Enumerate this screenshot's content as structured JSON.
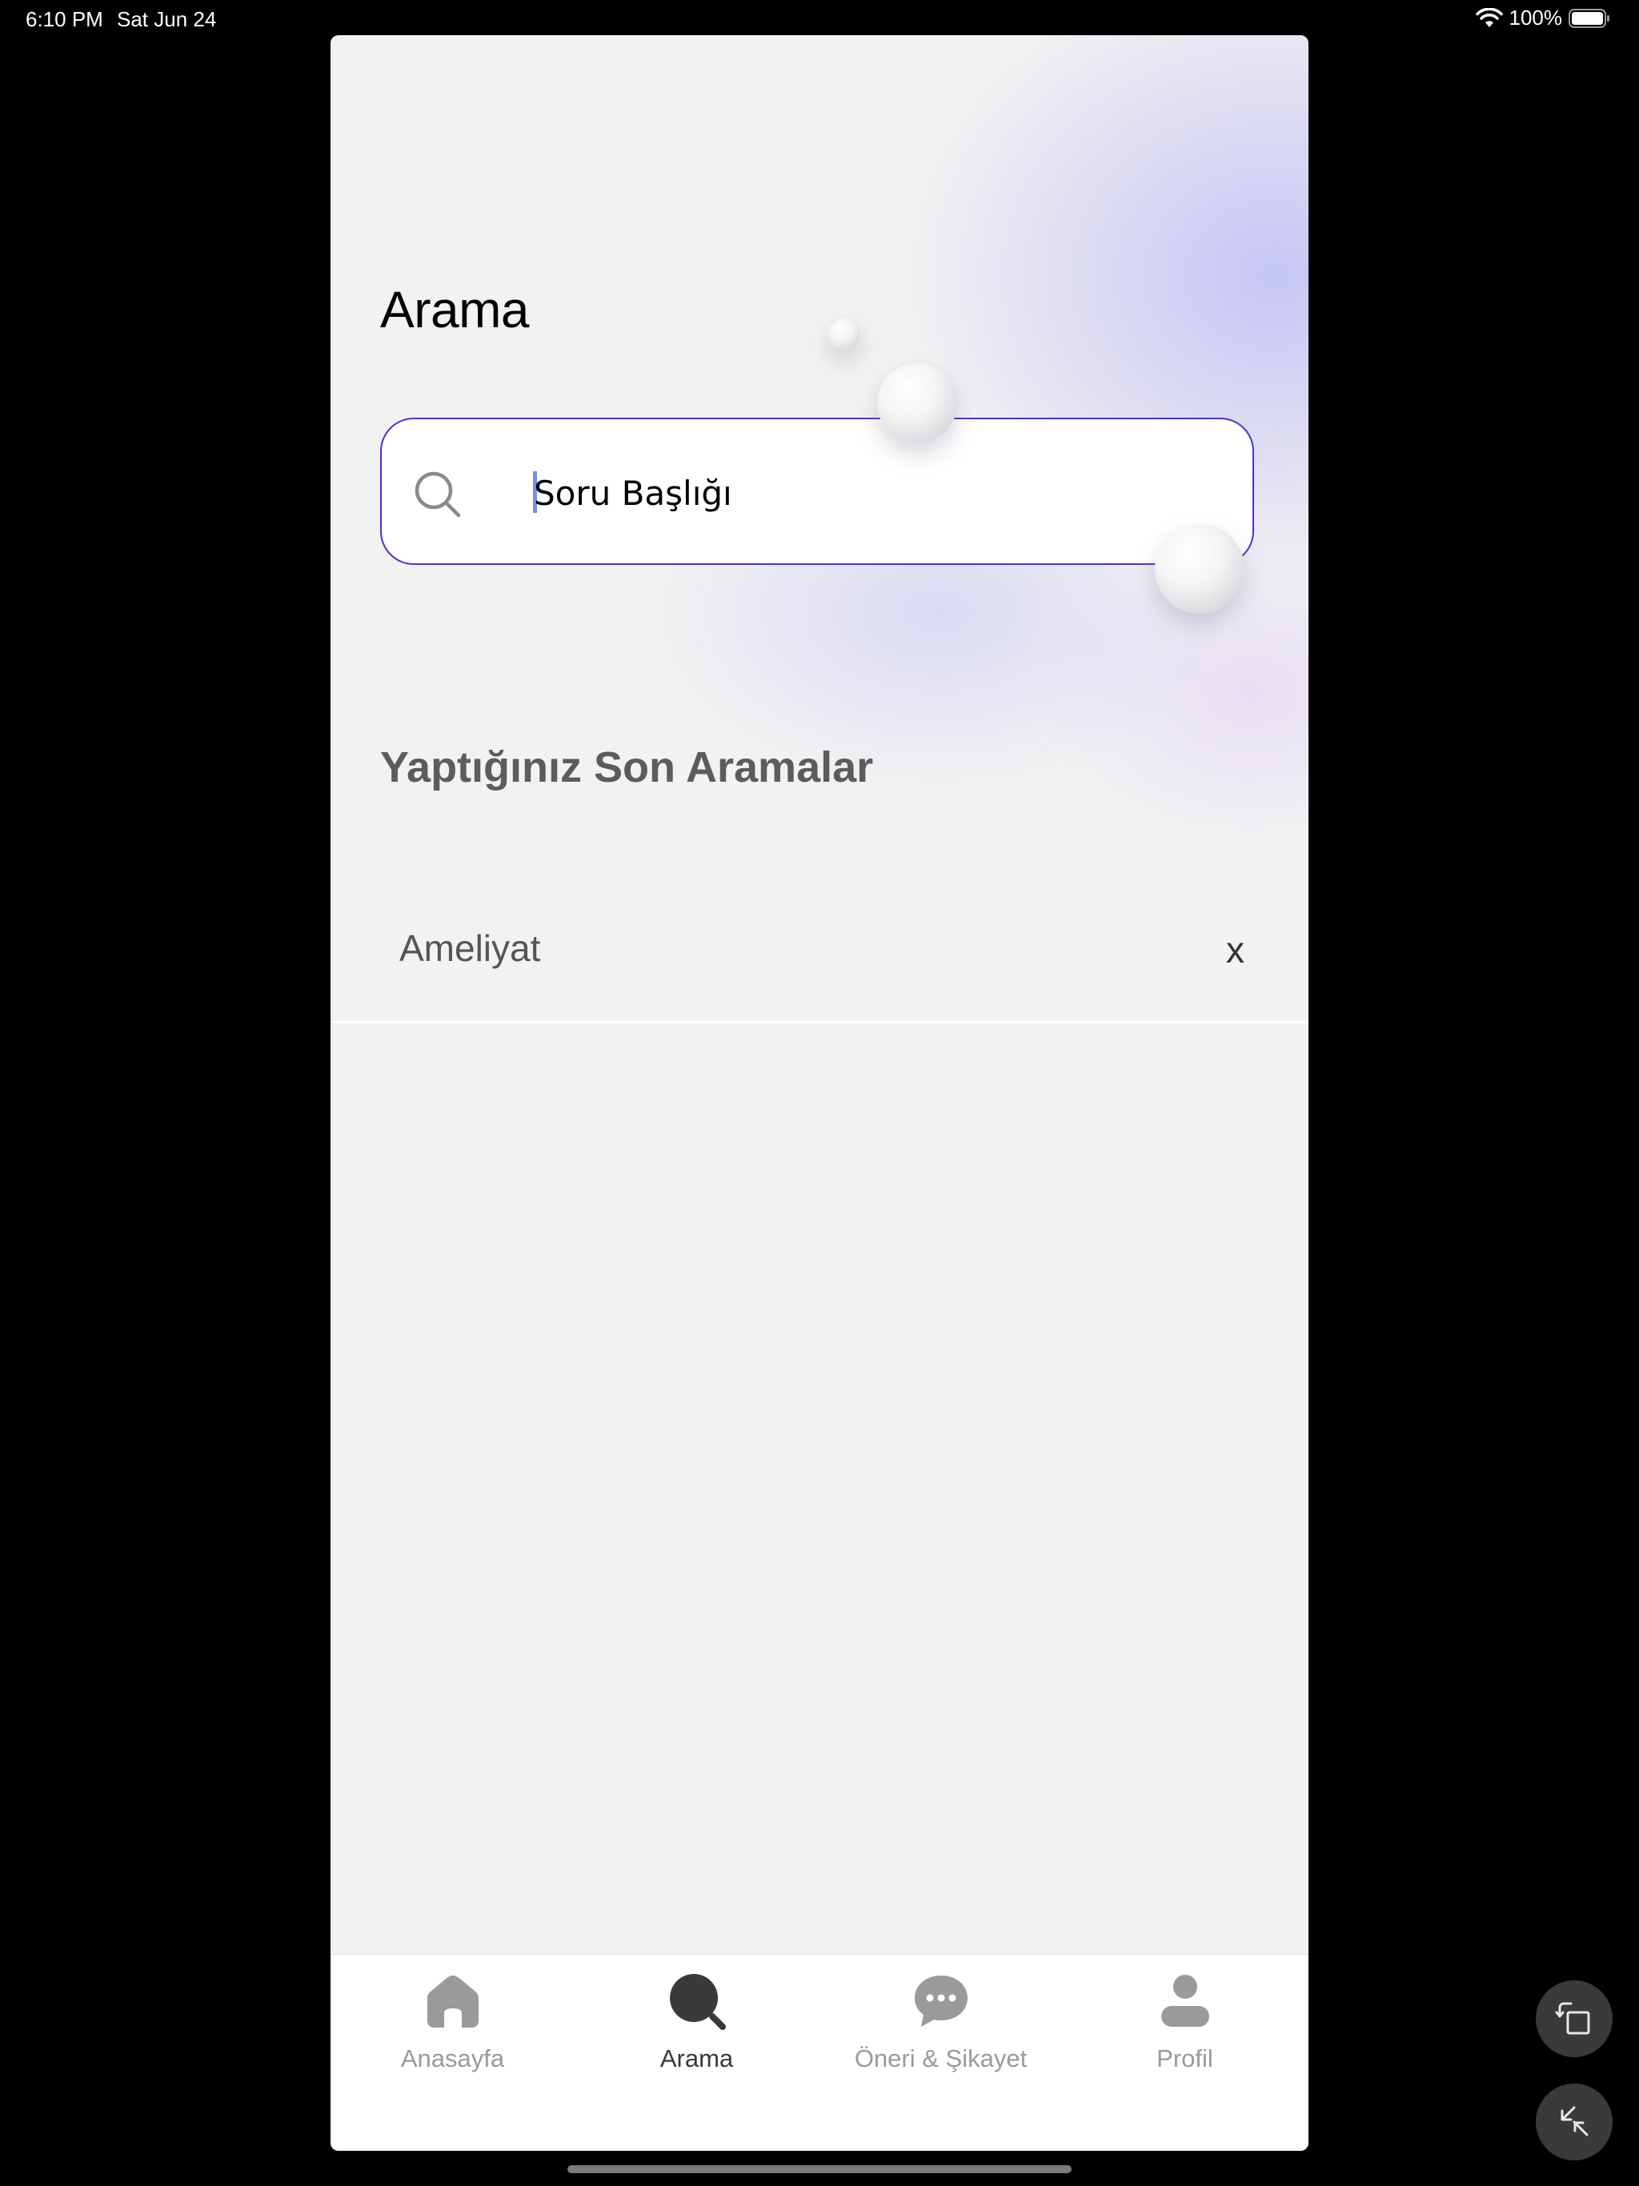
{
  "status_bar": {
    "time": "6:10 PM",
    "date": "Sat Jun 24",
    "battery": "100%"
  },
  "page": {
    "title": "Arama"
  },
  "search": {
    "value": "Soru Başlığı",
    "icon": "search-icon",
    "accent_color": "#4433dd"
  },
  "recent": {
    "title": "Yaptığınız Son Aramalar",
    "items": [
      {
        "label": "Ameliyat",
        "remove_label": "x"
      }
    ]
  },
  "tab_bar": {
    "active": "Arama",
    "tabs": [
      {
        "label": "Anasayfa",
        "icon": "home-icon"
      },
      {
        "label": "Arama",
        "icon": "search-icon"
      },
      {
        "label": "Öneri & Şikayet",
        "icon": "chat-bubble-icon"
      },
      {
        "label": "Profil",
        "icon": "profile-icon"
      }
    ]
  },
  "colors": {
    "inactive_tab": "#9a9a9a",
    "active_tab": "#3a3a3a",
    "background": "#f2f2f2"
  }
}
